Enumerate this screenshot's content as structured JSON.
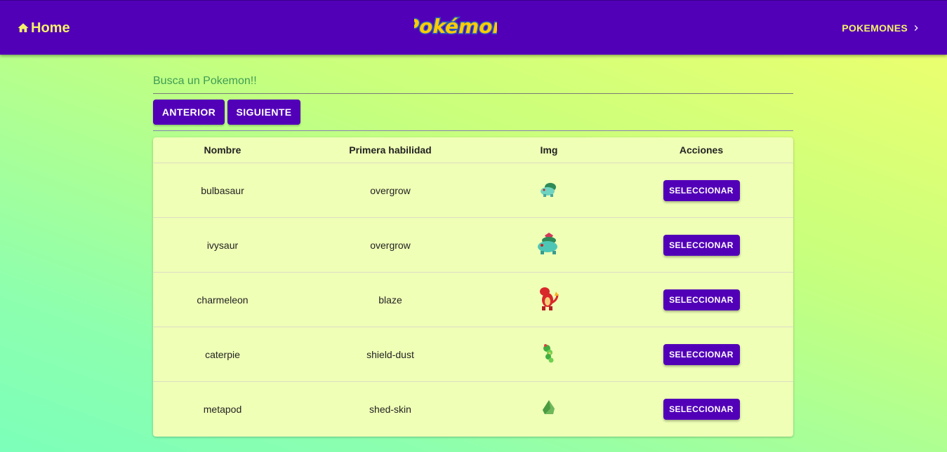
{
  "nav": {
    "home_label": "Home",
    "logo_text": "Pokémon",
    "right_label": "POKEMONES"
  },
  "search": {
    "placeholder": "Busca un Pokemon!!",
    "value": ""
  },
  "pagination": {
    "prev_label": "ANTERIOR",
    "next_label": "SIGUIENTE"
  },
  "table": {
    "headers": [
      "Nombre",
      "Primera habilidad",
      "Img",
      "Acciones"
    ],
    "action_label": "SELECCIONAR",
    "rows": [
      {
        "name": "bulbasaur",
        "ability": "overgrow",
        "sprite": "bulbasaur-sprite"
      },
      {
        "name": "ivysaur",
        "ability": "overgrow",
        "sprite": "ivysaur-sprite"
      },
      {
        "name": "charmeleon",
        "ability": "blaze",
        "sprite": "charmeleon-sprite"
      },
      {
        "name": "caterpie",
        "ability": "shield-dust",
        "sprite": "caterpie-sprite"
      },
      {
        "name": "metapod",
        "ability": "shed-skin",
        "sprite": "metapod-sprite"
      }
    ]
  },
  "colors": {
    "primary": "#5200b8",
    "accent": "#f3f26a",
    "table_bg": "#efffb6"
  }
}
